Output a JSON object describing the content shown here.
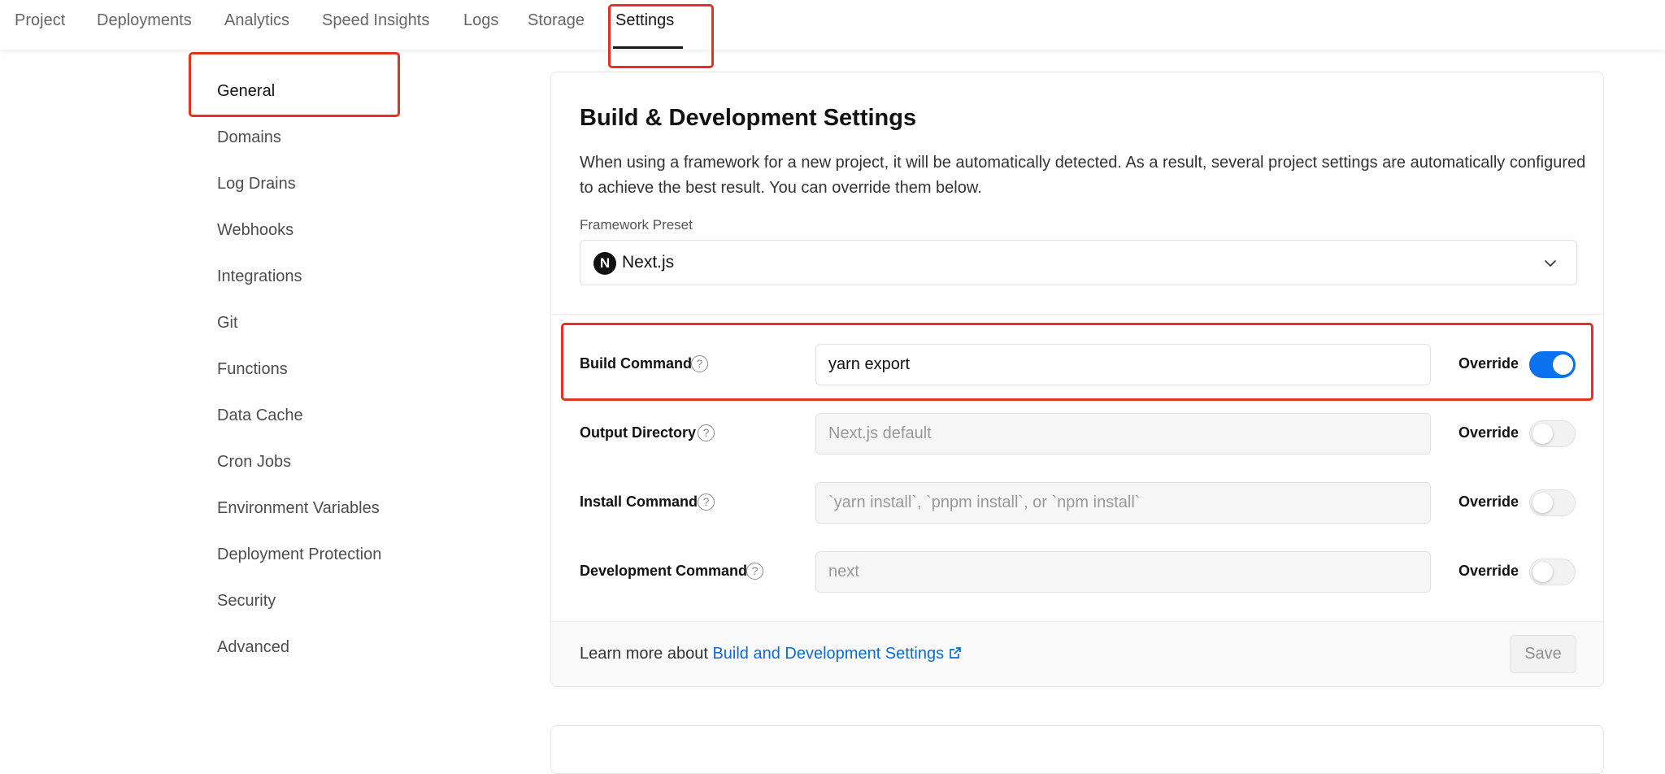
{
  "topnav": {
    "tabs": [
      {
        "label": "Project"
      },
      {
        "label": "Deployments"
      },
      {
        "label": "Analytics"
      },
      {
        "label": "Speed Insights"
      },
      {
        "label": "Logs"
      },
      {
        "label": "Storage"
      },
      {
        "label": "Settings",
        "active": true
      }
    ]
  },
  "sidebar": {
    "items": [
      {
        "label": "General",
        "active": true
      },
      {
        "label": "Domains"
      },
      {
        "label": "Log Drains"
      },
      {
        "label": "Webhooks"
      },
      {
        "label": "Integrations"
      },
      {
        "label": "Git"
      },
      {
        "label": "Functions"
      },
      {
        "label": "Data Cache"
      },
      {
        "label": "Cron Jobs"
      },
      {
        "label": "Environment Variables"
      },
      {
        "label": "Deployment Protection"
      },
      {
        "label": "Security"
      },
      {
        "label": "Advanced"
      }
    ]
  },
  "card": {
    "title": "Build & Development Settings",
    "description": "When using a framework for a new project, it will be automatically detected. As a result, several project settings are automatically configured to achieve the best result. You can override them below.",
    "preset_label": "Framework Preset",
    "preset_value": "Next.js",
    "preset_logo_letter": "N",
    "help_glyph": "?",
    "override_label": "Override",
    "rows": [
      {
        "label": "Build Command",
        "value": "yarn export",
        "placeholder": "",
        "override": true
      },
      {
        "label": "Output Directory",
        "value": "",
        "placeholder": "Next.js default",
        "override": false
      },
      {
        "label": "Install Command",
        "value": "",
        "placeholder": "`yarn install`, `pnpm install`, or `npm install`",
        "override": false
      },
      {
        "label": "Development Command",
        "value": "",
        "placeholder": "next",
        "override": false
      }
    ],
    "footer": {
      "text": "Learn more about",
      "link": "Build and Development Settings",
      "save_label": "Save"
    }
  },
  "colors": {
    "accent": "#0a72ef",
    "highlight": "#e5311f",
    "link": "#0a6cd8"
  }
}
